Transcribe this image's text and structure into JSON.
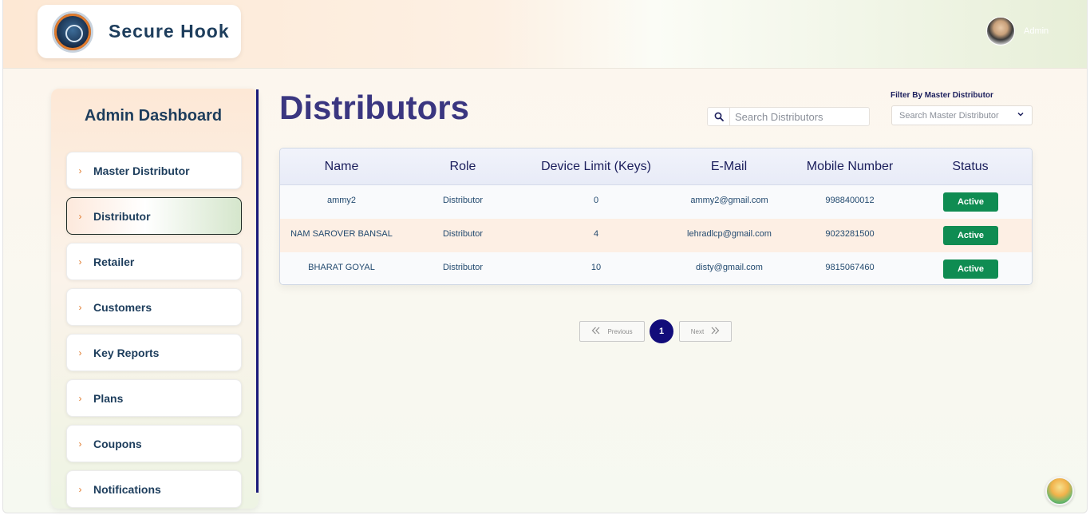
{
  "brand": {
    "name": "Secure Hook"
  },
  "user": {
    "name": "Admin"
  },
  "sidebar": {
    "title": "Admin Dashboard",
    "items": [
      {
        "label": "Master Distributor",
        "active": false
      },
      {
        "label": "Distributor",
        "active": true
      },
      {
        "label": "Retailer",
        "active": false
      },
      {
        "label": "Customers",
        "active": false
      },
      {
        "label": "Key Reports",
        "active": false
      },
      {
        "label": "Plans",
        "active": false
      },
      {
        "label": "Coupons",
        "active": false
      },
      {
        "label": "Notifications",
        "active": false
      }
    ]
  },
  "main": {
    "title": "Distributors",
    "search": {
      "placeholder": "Search Distributors"
    },
    "filter": {
      "label": "Filter By Master Distributor",
      "placeholder": "Search Master Distributor"
    }
  },
  "table": {
    "headers": [
      "Name",
      "Role",
      "Device Limit (Keys)",
      "E-Mail",
      "Mobile Number",
      "Status"
    ],
    "rows": [
      {
        "name": "ammy2",
        "role": "Distributor",
        "device_limit": "0",
        "email": "ammy2@gmail.com",
        "mobile": "9988400012",
        "status": "Active"
      },
      {
        "name": "NAM SAROVER BANSAL",
        "role": "Distributor",
        "device_limit": "4",
        "email": "lehradlcp@gmail.com",
        "mobile": "9023281500",
        "status": "Active"
      },
      {
        "name": "BHARAT GOYAL",
        "role": "Distributor",
        "device_limit": "10",
        "email": "disty@gmail.com",
        "mobile": "9815067460",
        "status": "Active"
      }
    ]
  },
  "pagination": {
    "previous_label": "Previous",
    "current_page": "1",
    "next_label": "Next"
  },
  "colors": {
    "accent": "#3a3680",
    "status_active": "#0f8c52",
    "nav_chevron": "#e07a2c"
  },
  "icons": {
    "search": "search-icon",
    "dropdown": "chevron-down-icon",
    "prev": "double-chevron-left-icon",
    "next": "double-chevron-right-icon"
  }
}
